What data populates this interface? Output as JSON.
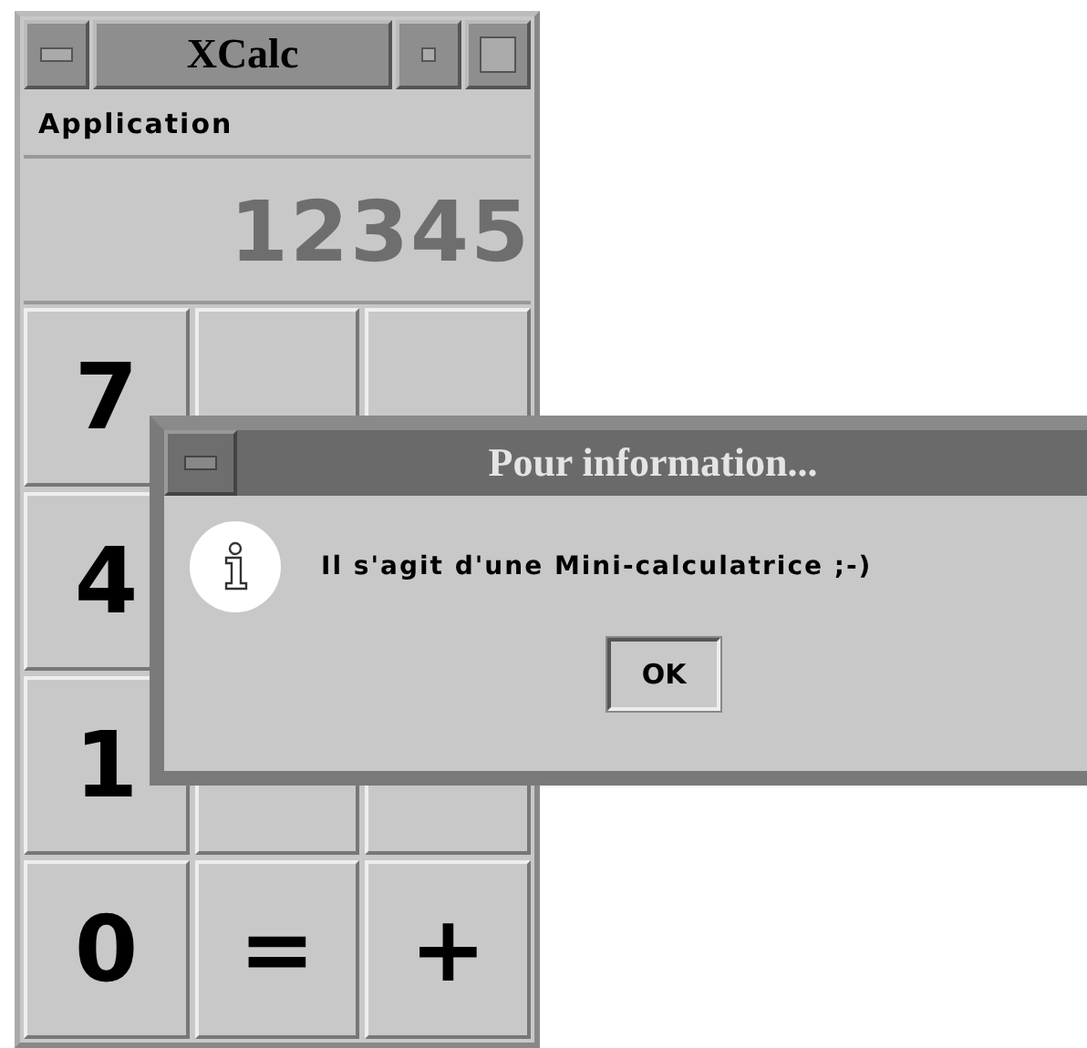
{
  "calculator": {
    "title": "XCalc",
    "menu": [
      {
        "label": "Application"
      }
    ],
    "display": "12345",
    "key_rows": [
      [
        "7"
      ],
      [
        "4"
      ],
      [
        "1"
      ],
      [
        "0",
        "=",
        "+"
      ]
    ]
  },
  "dialog": {
    "title": "Pour information...",
    "message": "Il s'agit d'une Mini-calculatrice ;-)",
    "buttons": [
      "OK"
    ]
  }
}
